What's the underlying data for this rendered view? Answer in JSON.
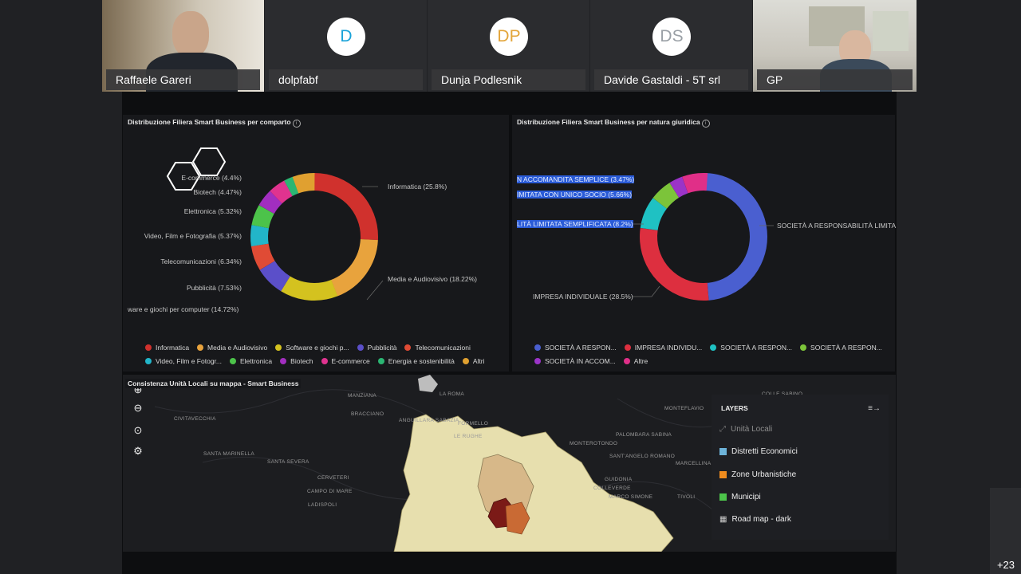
{
  "participants": [
    {
      "name": "Raffaele Gareri",
      "initials": "",
      "video": true
    },
    {
      "name": "dolpfabf",
      "initials": "D",
      "color": "#1aa3d9"
    },
    {
      "name": "Dunja Podlesnik",
      "initials": "DP",
      "color": "#e3a53a"
    },
    {
      "name": "Davide Gastaldi - 5T srl",
      "initials": "DS",
      "color": "#9aa0a6"
    },
    {
      "name": "GP",
      "initials": "",
      "video": true
    }
  ],
  "more_participants": "+23",
  "chart1": {
    "title": "Distribuzione Filiera Smart Business per comparto",
    "labels": {
      "ecommerce": "E-commerce (4.4%)",
      "biotech": "Biotech (4.47%)",
      "elettronica": "Elettronica (5.32%)",
      "video": "Video, Film e Fotografia (5.37%)",
      "telecom": "Telecomunicazioni (6.34%)",
      "pubblicita": "Pubblicità (7.53%)",
      "software": "ware e giochi per computer (14.72%)",
      "informatica": "Informatica (25.8%)",
      "media": "Media e Audiovisivo (18.22%)"
    },
    "legend_row1": [
      {
        "label": "Informatica",
        "color": "#d0312d"
      },
      {
        "label": "Media e Audiovisivo",
        "color": "#e8a33d"
      },
      {
        "label": "Software e giochi p...",
        "color": "#d4c21f"
      },
      {
        "label": "Pubblicità",
        "color": "#5b4fc9"
      },
      {
        "label": "Telecomunicazioni",
        "color": "#e04b35"
      }
    ],
    "legend_row2": [
      {
        "label": "Video, Film e Fotogr...",
        "color": "#22b5c9"
      },
      {
        "label": "Elettronica",
        "color": "#4cc34a"
      },
      {
        "label": "Biotech",
        "color": "#a22ec0"
      },
      {
        "label": "E-commerce",
        "color": "#e0338f"
      },
      {
        "label": "Energia e sostenibilità",
        "color": "#2bb673"
      },
      {
        "label": "Altri",
        "color": "#e0a030"
      }
    ]
  },
  "chart2": {
    "title": "Distribuzione Filiera Smart Business per natura giuridica",
    "labels": {
      "accomandita": "N ACCOMANDITA SEMPLICE (3.47%)",
      "unico_socio": "IMITATA CON UNICO SOCIO (5.66%)",
      "semplificata": "LITÀ LIMITATA SEMPLIFICATA (8.2%)",
      "impresa": "IMPRESA INDIVIDUALE (28.5%)",
      "srl": "SOCIETÀ A RESPONSABILITÀ LIMITA"
    },
    "legend_row1": [
      {
        "label": "SOCIETÀ A RESPON...",
        "color": "#4a5fd0"
      },
      {
        "label": "IMPRESA INDIVIDU...",
        "color": "#dd2f3f"
      },
      {
        "label": "SOCIETÀ A RESPON...",
        "color": "#1fc1c3"
      },
      {
        "label": "SOCIETÀ A RESPON...",
        "color": "#7cc43a"
      }
    ],
    "legend_row2": [
      {
        "label": "SOCIETÀ IN ACCOM...",
        "color": "#9b34c8"
      },
      {
        "label": "Altre",
        "color": "#e02f88"
      }
    ]
  },
  "map": {
    "title": "Consistenza Unità Locali su mappa - Smart Business",
    "places": {
      "manziana": "MANZIANA",
      "roma": "LA ROMA",
      "collesabino": "COLLE SABINO",
      "civitavecchia": "CIVITAVECCHIA",
      "bracciano": "BRACCIANO",
      "anguillara": "ANGUILLARA SABAZIA",
      "formello": "FORMELLO",
      "lerughe": "LE RUGHE",
      "monteflavio": "MONTEFLAVIO",
      "santamarinella": "SANTA MARINELLA",
      "santasevera": "SANTA SEVERA",
      "cerveteri": "CERVETERI",
      "campodimare": "CAMPO DI MARE",
      "ladispoli": "LADISPOLI",
      "monterotondo": "MONTEROTONDO",
      "palombara": "PALOMBARA SABINA",
      "santangelo": "SANT'ANGELO ROMANO",
      "marcellina": "MARCELLINA",
      "guidonia": "GUIDONIA",
      "collevecchio": "COLLEVERDE",
      "marcosimone": "MARCO SIMONE",
      "tivoli": "TIVOLI"
    },
    "layers": {
      "title": "LAYERS",
      "items": [
        {
          "label": "Unità Locali",
          "color": "",
          "muted": true
        },
        {
          "label": "Distretti Economici",
          "color": "#6db3d9"
        },
        {
          "label": "Zone Urbanistiche",
          "color": "#f08c1e"
        },
        {
          "label": "Municipi",
          "color": "#4cc34a"
        },
        {
          "label": "Road map - dark",
          "color": ""
        }
      ]
    }
  }
}
